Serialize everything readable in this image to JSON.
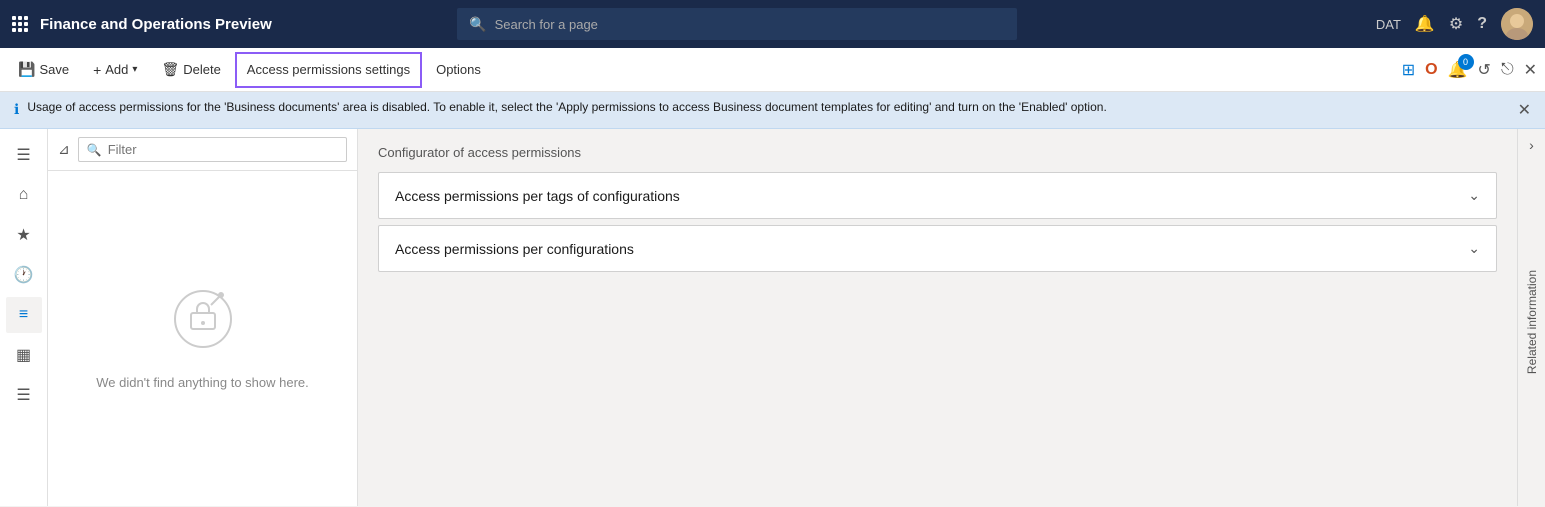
{
  "topbar": {
    "title": "Finance and Operations Preview",
    "search_placeholder": "Search for a page",
    "env_label": "DAT"
  },
  "actionbar": {
    "save_label": "Save",
    "add_label": "Add",
    "delete_label": "Delete",
    "active_tab_label": "Access permissions settings",
    "options_label": "Options"
  },
  "info_banner": {
    "text": "Usage of access permissions for the 'Business documents' area is disabled. To enable it, select the 'Apply permissions to access Business document templates for editing' and turn on the 'Enabled' option."
  },
  "list_panel": {
    "filter_placeholder": "Filter",
    "empty_text": "We didn't find anything to show here."
  },
  "content": {
    "title": "Configurator of access permissions",
    "accordion": [
      {
        "id": "tags",
        "label": "Access permissions per tags of configurations"
      },
      {
        "id": "configs",
        "label": "Access permissions per configurations"
      }
    ]
  },
  "right_panel": {
    "label": "Related information"
  },
  "icons": {
    "waffle": "⠿",
    "save": "💾",
    "add": "+",
    "delete": "🗑",
    "options": "⚙",
    "search_small": "🔍",
    "close": "✕",
    "home": "⌂",
    "star": "★",
    "clock": "🕐",
    "table": "▦",
    "list": "≡",
    "filter": "⊿",
    "bell": "🔔",
    "gear": "⚙",
    "question": "?",
    "chevron_down": "⌄",
    "power_apps": "⊞",
    "office": "O",
    "refresh": "↺",
    "external": "⎋",
    "right_arrow": "›",
    "search_top": "🔍"
  }
}
